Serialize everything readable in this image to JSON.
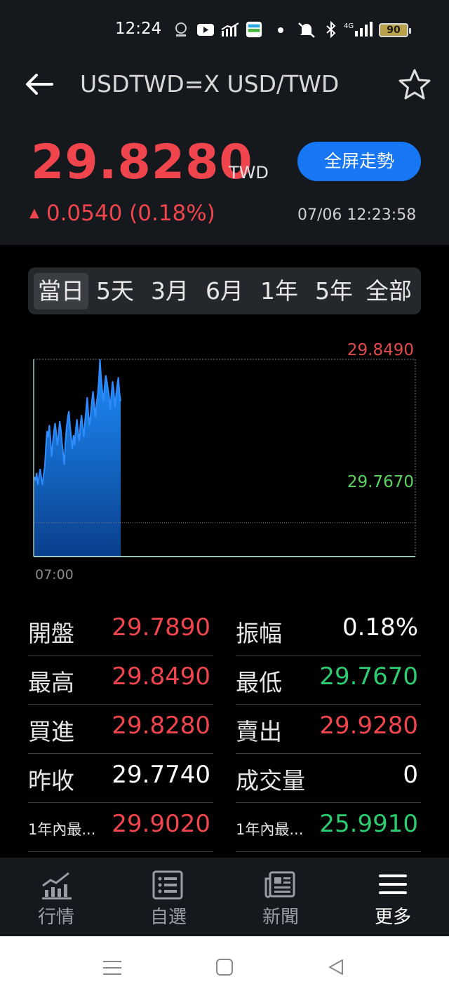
{
  "status_bar": {
    "time": "12:24",
    "battery": "90"
  },
  "header": {
    "title": "USDTWD=X USD/TWD",
    "price": "29.8280",
    "currency": "TWD",
    "fullscreen_label": "全屏走勢",
    "change": "0.0540 (0.18%)",
    "change_arrow": "▲",
    "timestamp": "07/06 12:23:58"
  },
  "tabs": [
    {
      "label": "當日",
      "active": true
    },
    {
      "label": "5天"
    },
    {
      "label": "3月"
    },
    {
      "label": "6月"
    },
    {
      "label": "1年"
    },
    {
      "label": "5年"
    },
    {
      "label": "全部"
    }
  ],
  "chart_data": {
    "type": "area",
    "x_start_label": "07:00",
    "high_label": "29.8490",
    "low_label": "29.7670",
    "ylim": [
      29.75,
      29.849
    ],
    "ref_line": 29.767,
    "values": [
      29.79,
      29.788,
      29.792,
      29.786,
      29.79,
      29.794,
      29.79,
      29.786,
      29.791,
      29.795,
      29.805,
      29.813,
      29.81,
      29.816,
      29.809,
      29.8,
      29.807,
      29.813,
      29.817,
      29.812,
      29.806,
      29.811,
      29.818,
      29.814,
      29.807,
      29.802,
      29.796,
      29.808,
      29.815,
      29.82,
      29.823,
      29.816,
      29.81,
      29.804,
      29.811,
      29.806,
      29.814,
      29.819,
      29.812,
      29.808,
      29.816,
      29.821,
      29.815,
      29.81,
      29.818,
      29.824,
      29.83,
      29.821,
      29.816,
      29.822,
      29.828,
      29.833,
      29.826,
      29.82,
      29.827,
      29.831,
      29.838,
      29.849,
      29.84,
      29.833,
      29.828,
      29.835,
      29.841,
      29.838,
      29.834,
      29.83,
      29.824,
      29.832,
      29.838,
      29.833,
      29.825,
      29.831,
      29.836,
      29.84,
      29.832,
      29.828
    ]
  },
  "stats": [
    {
      "left_label": "開盤",
      "left_value": "29.7890",
      "left_color": "red",
      "right_label": "振幅",
      "right_value": "0.18%",
      "right_color": "white"
    },
    {
      "left_label": "最高",
      "left_value": "29.8490",
      "left_color": "red",
      "right_label": "最低",
      "right_value": "29.7670",
      "right_color": "green"
    },
    {
      "left_label": "買進",
      "left_value": "29.8280",
      "left_color": "red",
      "right_label": "賣出",
      "right_value": "29.9280",
      "right_color": "red"
    },
    {
      "left_label": "昨收",
      "left_value": "29.7740",
      "left_color": "white",
      "right_label": "成交量",
      "right_value": "0",
      "right_color": "white"
    },
    {
      "left_label": "1年內最...",
      "left_value": "29.9020",
      "left_color": "red",
      "right_label": "1年內最...",
      "right_value": "25.9910",
      "right_color": "green",
      "small": true
    }
  ],
  "bottom_nav": [
    {
      "label": "行情",
      "icon": "chart-icon"
    },
    {
      "label": "自選",
      "icon": "watchlist-icon"
    },
    {
      "label": "新聞",
      "icon": "news-icon"
    },
    {
      "label": "更多",
      "icon": "menu-icon",
      "active": true
    }
  ]
}
